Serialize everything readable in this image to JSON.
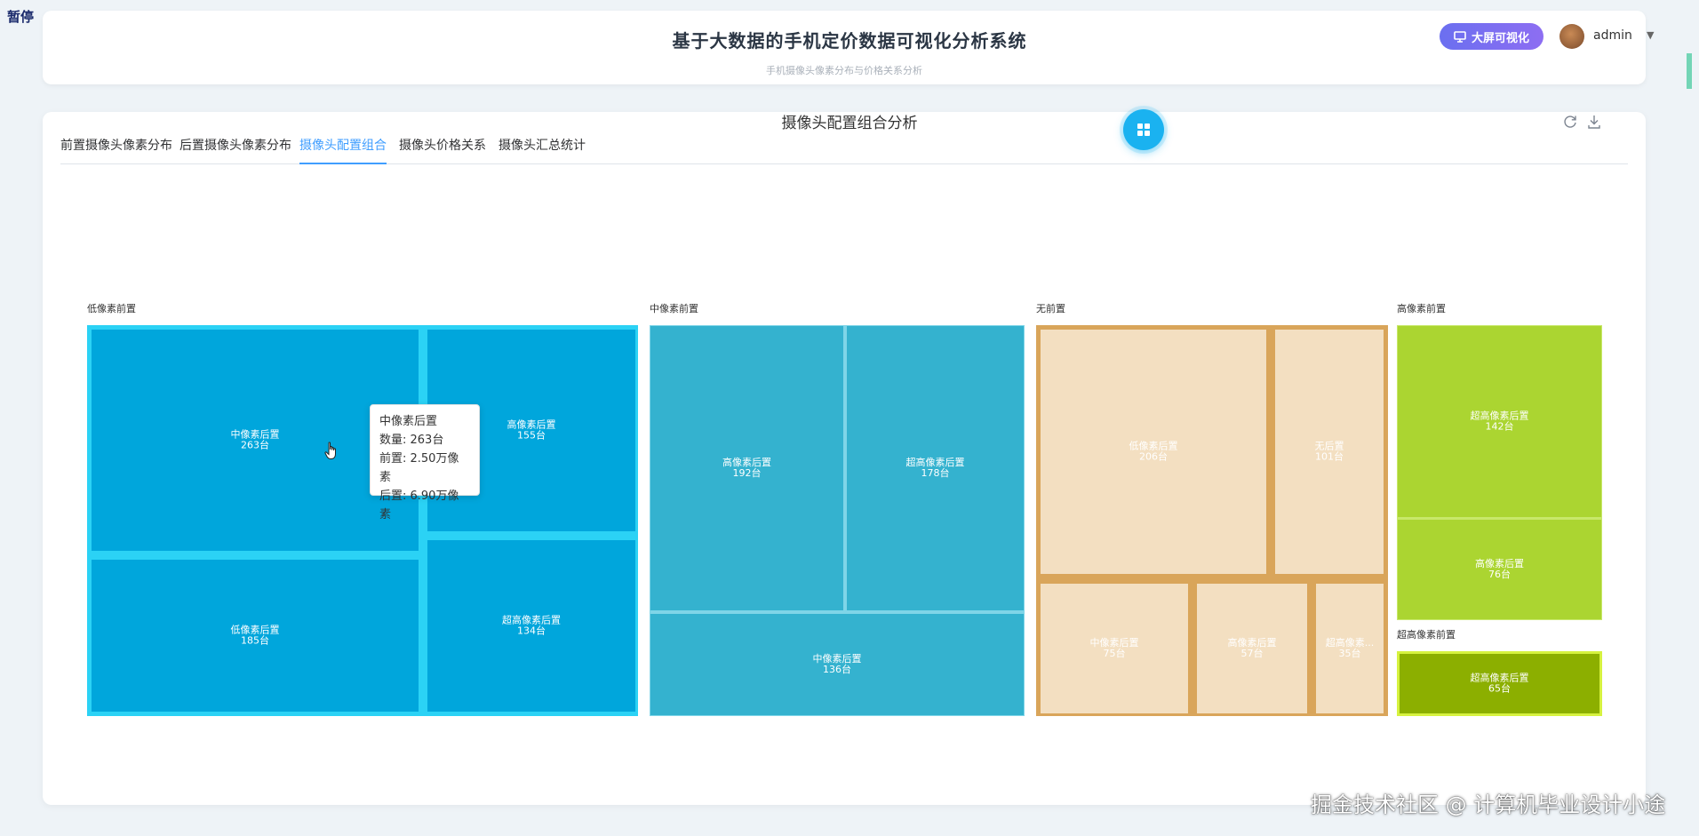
{
  "overlay": {
    "pause": "暂停"
  },
  "header": {
    "title": "基于大数据的手机定价数据可视化分析系统",
    "subtitle_faded": "手机摄像头像素分布与价格关系分析",
    "bigscreen_label": "大屏可视化",
    "username": "admin",
    "accent": "#7b6ff0"
  },
  "tabs": [
    {
      "label": "前置摄像头像素分布",
      "active": false
    },
    {
      "label": "后置摄像头像素分布",
      "active": false
    },
    {
      "label": "摄像头配置组合",
      "active": true
    },
    {
      "label": "摄像头价格关系",
      "active": false
    },
    {
      "label": "摄像头汇总统计",
      "active": false
    }
  ],
  "icons": {
    "bigscreen": "monitor-icon",
    "fab": "grid-icon",
    "refresh": "refresh-icon",
    "download": "download-icon",
    "caret": "chevron-down-icon"
  },
  "chart_data": {
    "type": "treemap",
    "title": "摄像头配置组合分析",
    "unit": "台",
    "groups": [
      {
        "name": "低像素前置",
        "color": "#00a6dc",
        "border": "#2bd2f5",
        "text_color": "#ffffff",
        "children": [
          {
            "name": "中像素后置",
            "value": 263
          },
          {
            "name": "低像素后置",
            "value": 185
          },
          {
            "name": "高像素后置",
            "value": 155
          },
          {
            "name": "超高像素后置",
            "value": 134
          }
        ]
      },
      {
        "name": "中像素前置",
        "color": "#34b2cf",
        "border": "#7fd5e8",
        "text_color": "#ffffff",
        "children": [
          {
            "name": "高像素后置",
            "value": 192
          },
          {
            "name": "超高像素后置",
            "value": 178
          },
          {
            "name": "中像素后置",
            "value": 136
          }
        ]
      },
      {
        "name": "无前置",
        "color": "#f3dfc1",
        "border": "#d9a55a",
        "text_color": "#ffffff",
        "children": [
          {
            "name": "低像素后置",
            "value": 206
          },
          {
            "name": "无后置",
            "value": 101
          },
          {
            "name": "中像素后置",
            "value": 75
          },
          {
            "name": "高像素后置",
            "value": 57
          },
          {
            "name": "超高像素...",
            "value": 35
          }
        ]
      },
      {
        "name": "高像素前置",
        "color": "#abd531",
        "border": "#c8e86a",
        "text_color": "#ffffff",
        "children": [
          {
            "name": "超高像素后置",
            "value": 142
          },
          {
            "name": "高像素后置",
            "value": 76
          }
        ]
      },
      {
        "name": "超高像素前置",
        "color": "#8caf00",
        "border": "#d6f23f",
        "text_color": "#ffffff",
        "children": [
          {
            "name": "超高像素后置",
            "value": 65
          }
        ]
      }
    ]
  },
  "tooltip": {
    "title": "中像素后置",
    "line1": "数量: 263台",
    "line2": "前置: 2.50万像素",
    "line3": "后置: 6.90万像素"
  },
  "watermark": "掘金技术社区 @ 计算机毕业设计小途"
}
